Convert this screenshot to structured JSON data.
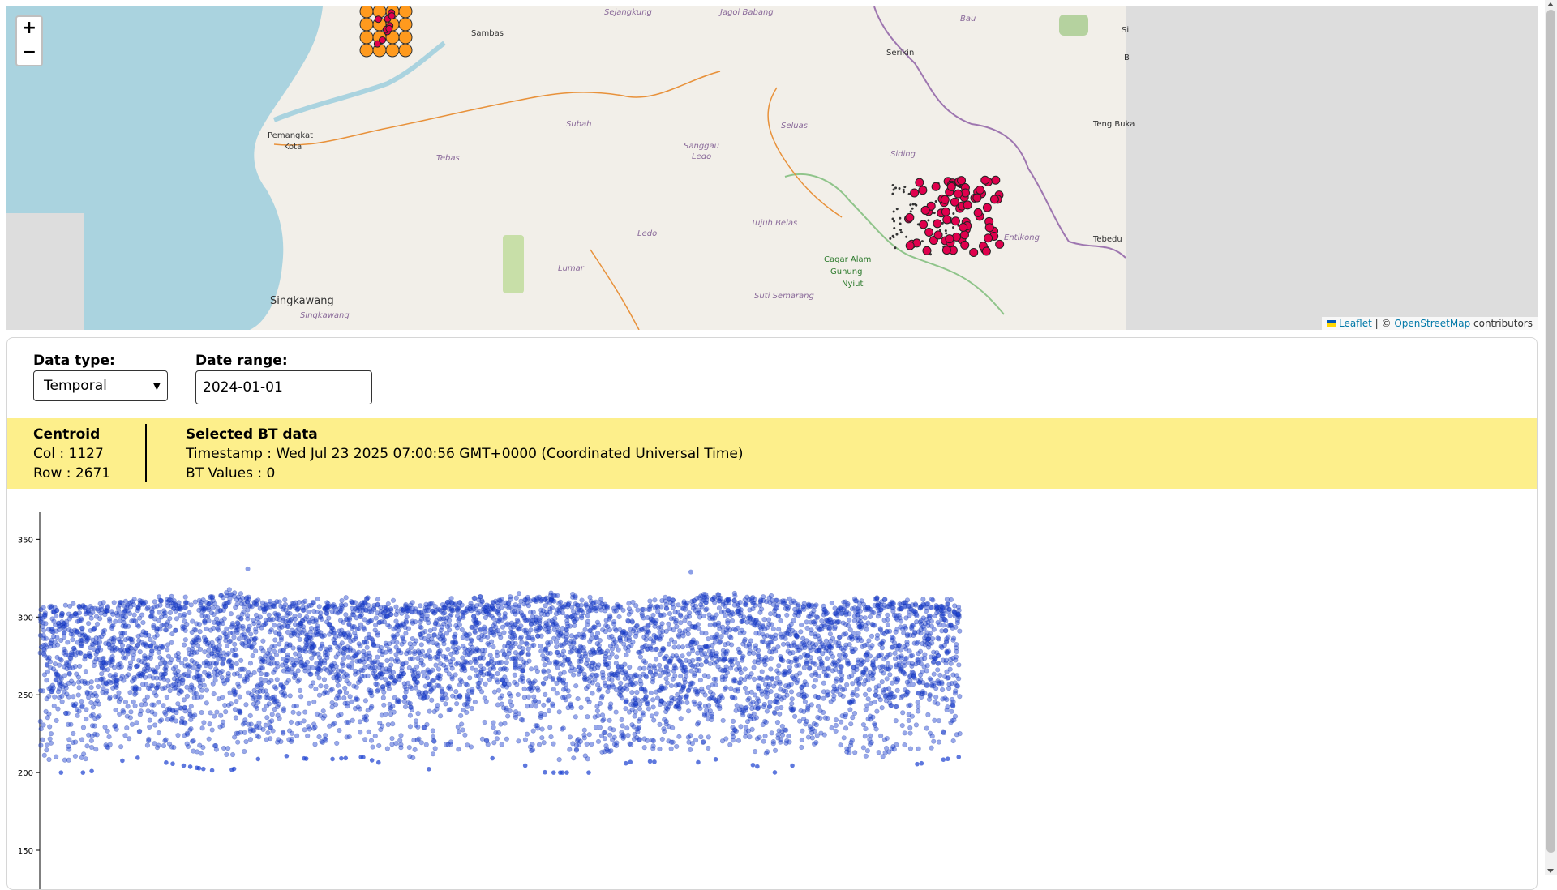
{
  "map": {
    "zoom_in": "+",
    "zoom_out": "−",
    "attribution": {
      "leaflet": "Leaflet",
      "sep": "| ©",
      "osm": "OpenStreetMap",
      "suffix": "contributors"
    },
    "places": [
      {
        "name": "Sejangkung"
      },
      {
        "name": "Jagoi Babang"
      },
      {
        "name": "Bau"
      },
      {
        "name": "Sambas"
      },
      {
        "name": "Serikin"
      },
      {
        "name": "Pemangkat"
      },
      {
        "name": "Kota"
      },
      {
        "name": "Subah"
      },
      {
        "name": "Seluas"
      },
      {
        "name": "Tebas"
      },
      {
        "name": "Sanggau"
      },
      {
        "name": "Ledo"
      },
      {
        "name": "Siding"
      },
      {
        "name": "Teng Buka"
      },
      {
        "name": "Tujuh Belas"
      },
      {
        "name": "Ledo"
      },
      {
        "name": "Entikong"
      },
      {
        "name": "Tebedu"
      },
      {
        "name": "Cagar Alam"
      },
      {
        "name": "Gunung"
      },
      {
        "name": "Nyiut"
      },
      {
        "name": "Lumar"
      },
      {
        "name": "Singkawang"
      },
      {
        "name": "Singkawang"
      },
      {
        "name": "Suti Semarang"
      },
      {
        "name": "Si"
      },
      {
        "name": "B"
      }
    ],
    "colors": {
      "sea": "#aad3df",
      "land": "#f2efe9",
      "grey": "#dddddd",
      "road": "#e8913a",
      "border": "#9e76b0",
      "park": "#b5d29f",
      "marker_red": "#e0004d",
      "marker_orange": "#ff9a1e"
    }
  },
  "controls": {
    "data_type_label": "Data type:",
    "data_type_value": "Temporal",
    "date_range_label": "Date range:",
    "date_range_value": "2024-01-01"
  },
  "info": {
    "centroid_title": "Centroid",
    "col": "Col : 1127",
    "row": "Row : 2671",
    "selected_title": "Selected BT data",
    "timestamp": "Timestamp : Wed Jul 23 2025 07:00:56 GMT+0000 (Coordinated Universal Time)",
    "bt_values": "BT Values : 0"
  },
  "chart_data": {
    "type": "scatter",
    "title": "",
    "xlabel": "",
    "ylabel": "",
    "y_ticks": [
      150,
      200,
      250,
      300,
      350
    ],
    "ylim": [
      125,
      370
    ],
    "x_extent_fraction": [
      0.0,
      0.62
    ],
    "color": "#1a3fd0",
    "envelope": {
      "x_fraction": [
        0.0,
        0.05,
        0.1,
        0.15,
        0.2,
        0.25,
        0.3,
        0.35,
        0.4,
        0.45,
        0.5,
        0.55,
        0.6,
        0.65,
        0.7,
        0.75,
        0.8,
        0.85,
        0.9,
        0.95,
        1.0
      ],
      "upper": [
        307,
        308,
        310,
        312,
        316,
        310,
        309,
        311,
        308,
        310,
        312,
        316,
        310,
        308,
        312,
        315,
        313,
        308,
        310,
        311,
        309
      ],
      "typical_low": [
        255,
        240,
        258,
        245,
        260,
        238,
        262,
        250,
        243,
        258,
        255,
        262,
        248,
        238,
        255,
        250,
        245,
        255,
        240,
        250,
        252
      ],
      "min": [
        200,
        200,
        210,
        205,
        200,
        212,
        208,
        210,
        200,
        205,
        210,
        200,
        200,
        208,
        205,
        210,
        200,
        212,
        200,
        205,
        210
      ]
    },
    "outliers": [
      {
        "x_fraction": 0.225,
        "y": 331
      },
      {
        "x_fraction": 0.708,
        "y": 329
      }
    ]
  }
}
